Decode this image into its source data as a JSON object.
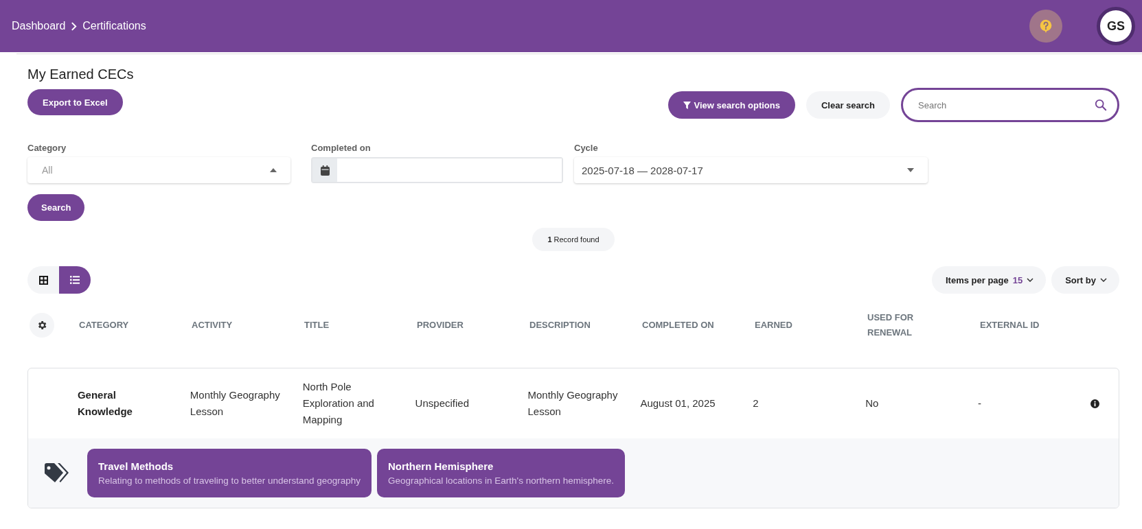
{
  "breadcrumb": [
    "Dashboard",
    "Certifications"
  ],
  "user_avatar": {
    "initials": "GS"
  },
  "page_title": "My Earned CECs",
  "export_button": "Export to Excel",
  "toolbar": {
    "search_options_button": "View search options",
    "clear_button": "Clear search",
    "search": {
      "placeholder": "Search"
    }
  },
  "filters": [
    {
      "kind": "select",
      "label": "Category",
      "placeholder": "All",
      "expanded": true
    },
    {
      "kind": "date",
      "label": "Completed on"
    },
    {
      "kind": "select",
      "label": "Cycle",
      "value": "2025-07-18 — 2028-07-17",
      "expanded": false
    }
  ],
  "search_button": "Search",
  "record_count": {
    "count": "1",
    "text": "Record found"
  },
  "view_toggle": [
    {
      "kind": "grid",
      "selected": false
    },
    {
      "kind": "list",
      "selected": true
    }
  ],
  "items_per_page": {
    "label": "Items per page",
    "value": "15"
  },
  "sort_button": "Sort by",
  "table": {
    "columns": [
      "CATEGORY",
      "ACTIVITY",
      "TITLE",
      "PROVIDER",
      "DESCRIPTION",
      "COMPLETED ON",
      "EARNED",
      "USED FOR RENEWAL",
      "EXTERNAL ID"
    ],
    "rows": [
      {
        "cells": [
          "General Knowledge",
          "Monthly Geography Lesson",
          "North Pole Exploration and Mapping",
          "Unspecified",
          "Monthly Geography Lesson",
          "August 01, 2025",
          "2",
          "No",
          "-"
        ],
        "tags": [
          {
            "title": "Travel Methods",
            "description": "Relating to methods of traveling to better understand geography"
          },
          {
            "title": "Northern Hemisphere",
            "description": "Geographical locations in Earth's northern hemisphere."
          }
        ]
      }
    ]
  }
}
